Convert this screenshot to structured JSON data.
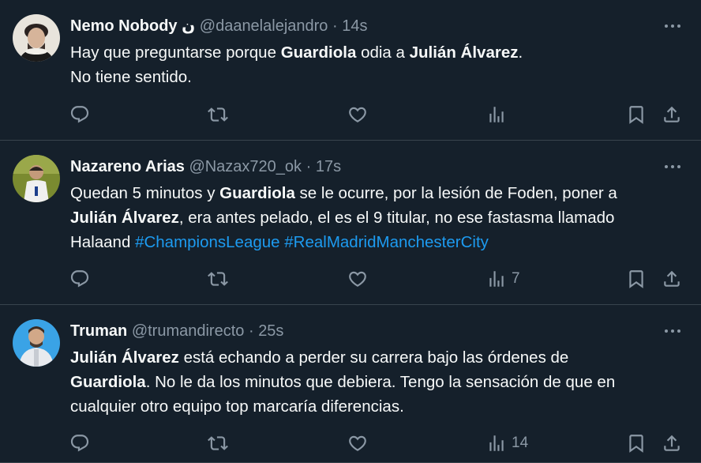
{
  "tweets": [
    {
      "name": "Nemo Nobody",
      "name_suffix": "ن",
      "handle": "@daanelalejandro",
      "dot": "·",
      "time": "14s",
      "text": [
        {
          "t": "Hay que preguntarse porque "
        },
        {
          "t": "Guardiola",
          "b": true
        },
        {
          "t": " odia a "
        },
        {
          "t": "Julián Álvarez",
          "b": true
        },
        {
          "t": ".\nNo tiene sentido."
        }
      ],
      "views": ""
    },
    {
      "name": "Nazareno Arias",
      "name_suffix": "",
      "handle": "@Nazax720_ok",
      "dot": "·",
      "time": "17s",
      "text": [
        {
          "t": "Quedan 5 minutos y "
        },
        {
          "t": "Guardiola",
          "b": true
        },
        {
          "t": " se le ocurre, por la lesión de Foden, poner a\n"
        },
        {
          "t": "Julián Álvarez",
          "b": true
        },
        {
          "t": ", era antes pelado, el es el 9 titular, no ese fastasma llamado\nHalaand "
        },
        {
          "t": "#ChampionsLeague",
          "h": true
        },
        {
          "t": " "
        },
        {
          "t": "#RealMadridManchesterCity",
          "h": true
        }
      ],
      "views": "7"
    },
    {
      "name": "Truman",
      "name_suffix": "",
      "handle": "@trumandirecto",
      "dot": "·",
      "time": "25s",
      "text": [
        {
          "t": "Julián Álvarez",
          "b": true
        },
        {
          "t": " está echando a perder su carrera bajo las órdenes de\n"
        },
        {
          "t": "Guardiola",
          "b": true
        },
        {
          "t": ". No le da los minutos que debiera. Tengo la sensación de que en\ncualquier otro equipo top marcaría diferencias."
        }
      ],
      "views": "14"
    }
  ],
  "icons": {
    "reply": "reply-icon",
    "retweet": "retweet-icon",
    "like": "heart-icon",
    "views": "views-icon",
    "bookmark": "bookmark-icon",
    "share": "share-icon",
    "more": "more-icon"
  },
  "colors": {
    "background": "#15202b",
    "text": "#f7f9f9",
    "muted": "#8b98a5",
    "hashtag": "#1d9bf0",
    "divider": "#38444d"
  }
}
